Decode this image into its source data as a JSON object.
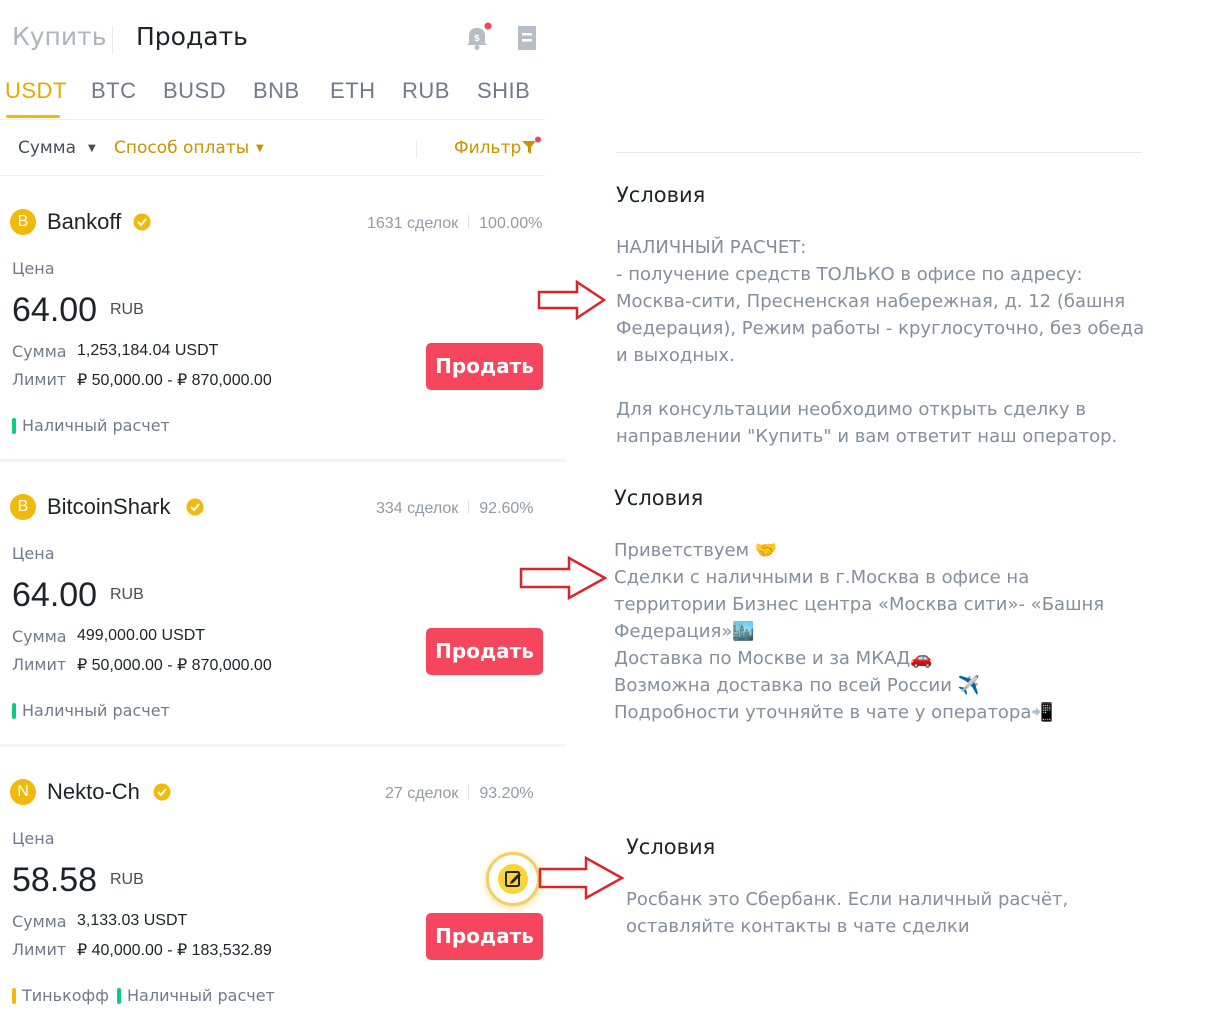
{
  "header": {
    "buy_label": "Купить",
    "sell_label": "Продать"
  },
  "tabs": [
    {
      "label": "USDT",
      "active": true
    },
    {
      "label": "BTC",
      "active": false
    },
    {
      "label": "BUSD",
      "active": false
    },
    {
      "label": "BNB",
      "active": false
    },
    {
      "label": "ETH",
      "active": false
    },
    {
      "label": "RUB",
      "active": false
    },
    {
      "label": "SHIB",
      "active": false
    }
  ],
  "filters": {
    "amount_label": "Сумма",
    "payment_label": "Способ оплаты",
    "filter_label": "Фильтр"
  },
  "offers": [
    {
      "avatar_letter": "B",
      "name": "Bankoff",
      "trades": "1631 сделок",
      "completion": "100.00%",
      "price_label": "Цена",
      "price": "64.00",
      "currency": "RUB",
      "amount_label": "Сумма",
      "amount": "1,253,184.04 USDT",
      "limit_label": "Лимит",
      "limit": "₽ 50,000.00 - ₽ 870,000.00",
      "payments": [
        "Наличный расчет"
      ],
      "button_label": "Продать"
    },
    {
      "avatar_letter": "B",
      "name": "BitcoinShark",
      "trades": "334 сделок",
      "completion": "92.60%",
      "price_label": "Цена",
      "price": "64.00",
      "currency": "RUB",
      "amount_label": "Сумма",
      "amount": "499,000.00 USDT",
      "limit_label": "Лимит",
      "limit": "₽ 50,000.00 - ₽ 870,000.00",
      "payments": [
        "Наличный расчет"
      ],
      "button_label": "Продать"
    },
    {
      "avatar_letter": "N",
      "name": "Nekto-Ch",
      "trades": "27 сделок",
      "completion": "93.20%",
      "price_label": "Цена",
      "price": "58.58",
      "currency": "RUB",
      "amount_label": "Сумма",
      "amount": "3,133.03 USDT",
      "limit_label": "Лимит",
      "limit": "₽ 40,000.00 - ₽ 183,532.89",
      "payments": [
        "Тинькофф",
        "Наличный расчет"
      ],
      "button_label": "Продать"
    }
  ],
  "conditions": [
    {
      "title": "Условия",
      "text": "НАЛИЧНЫЙ РАСЧЕТ:\n- получение средств ТОЛЬКО в офисе по адресу:\nМосква-сити, Пресненская набережная, д. 12 (башня\nФедерация), Режим работы - круглосуточно, без обеда\nи выходных.\n\nДля консультации необходимо открыть сделку в\nнаправлении \"Купить\" и вам ответит наш оператор."
    },
    {
      "title": "Условия",
      "text": "Приветствуем 🤝\nСделки с наличными в г.Москва в офисе на\nтерритории Бизнес центра «Москва сити»- «Башня\nФедерация»🏙️\nДоставка по Москве и за МКАД🚗\nВозможна доставка по всей России ✈️\nПодробности уточняйте в чате у оператора📲"
    },
    {
      "title": "Условия",
      "text": "Росбанк это Сбербанк. Если наличный расчёт,\nоставляйте контакты в чате сделки"
    }
  ],
  "colors": {
    "accent": "#f0b90b",
    "sell": "#f6465d",
    "cash_tag": "#0ecb81",
    "tinkoff_tag": "#f0b90b",
    "arrow": "#d9262c"
  }
}
